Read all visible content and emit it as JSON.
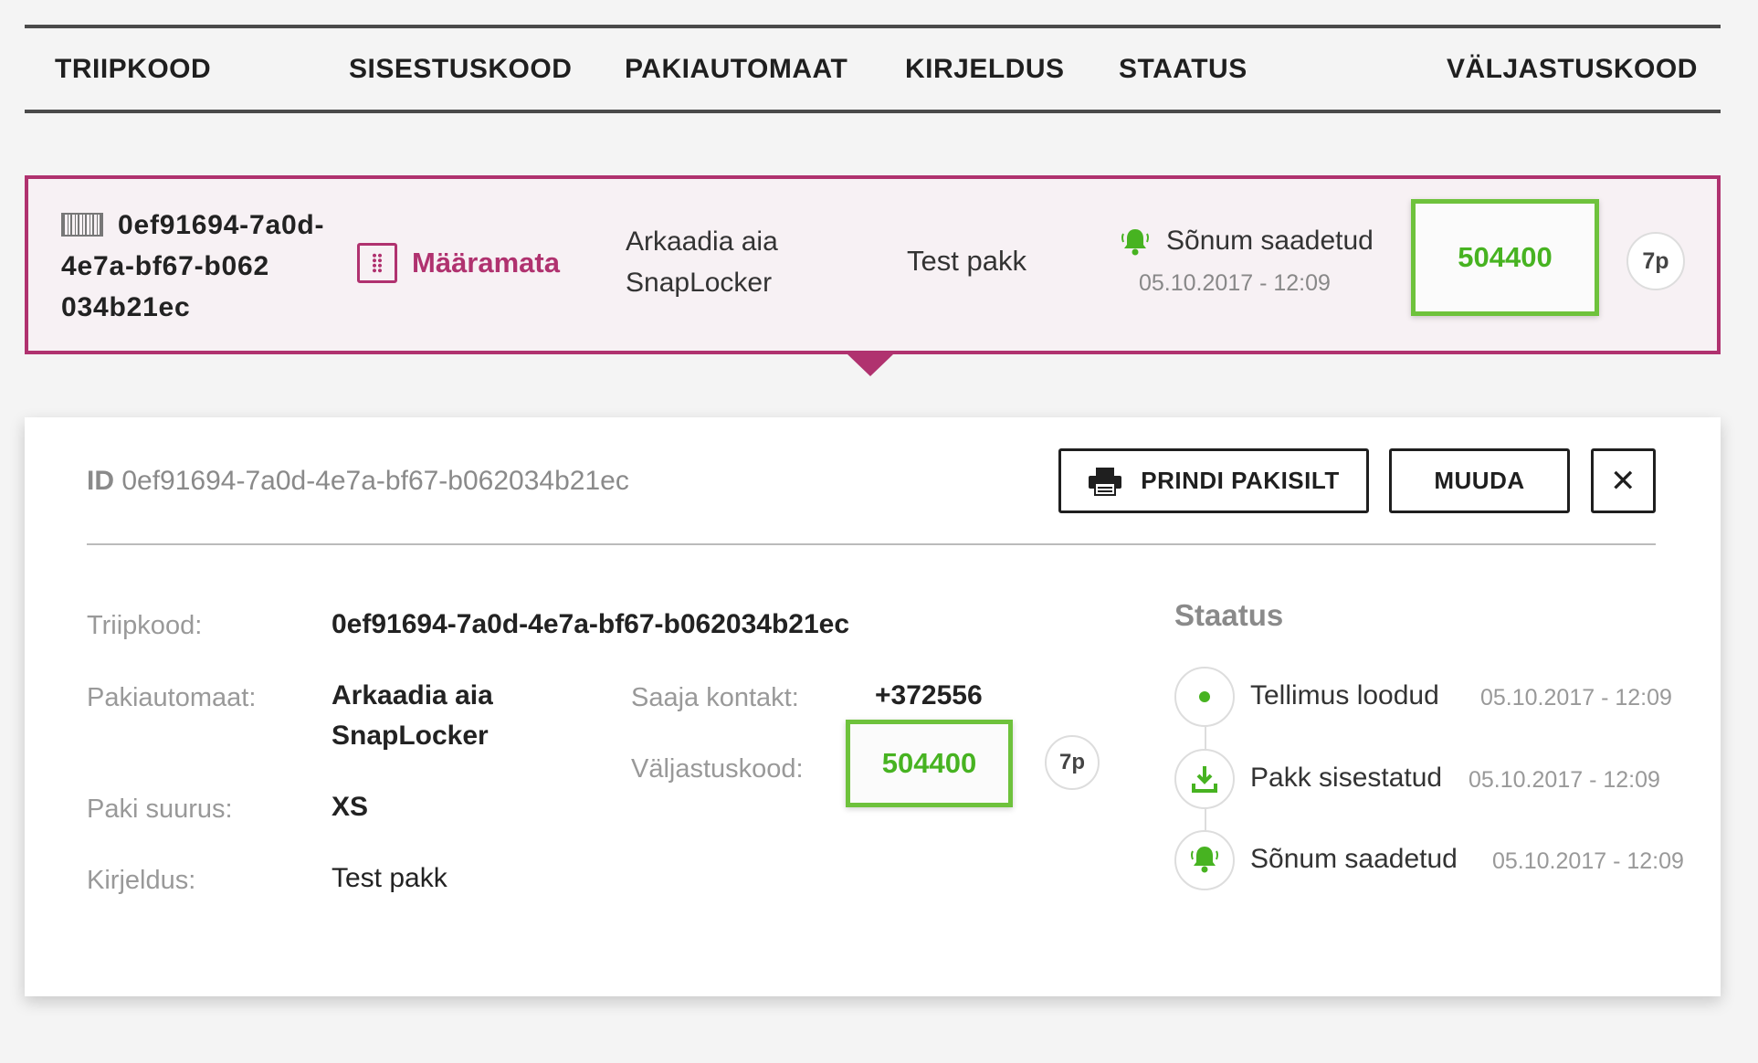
{
  "table": {
    "headers": [
      "TRIIPKOOD",
      "SISESTUSKOOD",
      "PAKIAUTOMAAT",
      "KIRJELDUS",
      "STAATUS",
      "VÄLJASTUSKOOD"
    ]
  },
  "row": {
    "barcode_lines": [
      "0ef91694-7a0d-",
      "4e7a-bf67-b062",
      "034b21ec"
    ],
    "entry_code": "Määramata",
    "locker_lines": [
      "Arkaadia aia",
      "SnapLocker"
    ],
    "description": "Test pakk",
    "status": "Sõnum saadetud",
    "status_date": "05.10.2017 - 12:09",
    "release_code": "504400",
    "days": "7p"
  },
  "panel": {
    "id_label": "ID",
    "id_value": "0ef91694-7a0d-4e7a-bf67-b062034b21ec",
    "print_button": "PRINDI PAKISILT",
    "edit_button": "MUUDA",
    "close_button": "✕",
    "barcode_label": "Triipkood:",
    "barcode_value": "0ef91694-7a0d-4e7a-bf67-b062034b21ec",
    "locker_label": "Pakiautomaat:",
    "locker_lines": [
      "Arkaadia aia",
      "SnapLocker"
    ],
    "size_label": "Paki suurus:",
    "size_value": "XS",
    "description_label": "Kirjeldus:",
    "description_value": "Test pakk",
    "contact_label": "Saaja kontakt:",
    "contact_value": "+372556",
    "release_label": "Väljastuskood:",
    "release_code": "504400",
    "days": "7p",
    "status_title": "Staatus",
    "timeline": [
      {
        "label": "Tellimus loodud",
        "date": "05.10.2017 - 12:09",
        "icon": "dot-icon"
      },
      {
        "label": "Pakk sisestatud",
        "date": "05.10.2017 - 12:09",
        "icon": "download-icon"
      },
      {
        "label": "Sõnum saadetud",
        "date": "05.10.2017 - 12:09",
        "icon": "bell-icon"
      }
    ]
  },
  "colors": {
    "accent": "#b0326f",
    "success": "#47b321",
    "highlight_border": "#6ec23c"
  }
}
